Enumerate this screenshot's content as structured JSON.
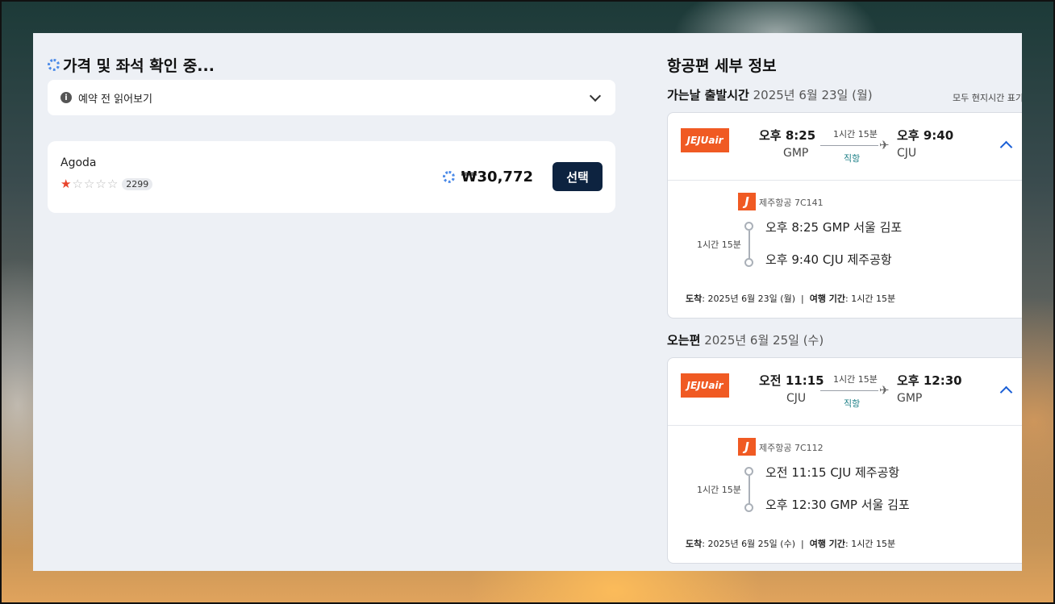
{
  "left": {
    "checking_text": "가격 및 좌석 확인 중...",
    "read_before": "예약 전 읽어보기",
    "offer": {
      "provider": "Agoda",
      "rating": 1,
      "rating_max": 5,
      "reviews": "2299",
      "price": "₩30,772",
      "select_label": "선택"
    }
  },
  "right": {
    "title": "항공편 세부 정보",
    "local_time_note": "모두 현지시간 표기",
    "legs": [
      {
        "label": "가는날 출발시간",
        "date": "2025년 6월 23일 (월)",
        "airline_logo": "JEJUair",
        "dep_time": "오후 8:25",
        "dep_code": "GMP",
        "duration": "1시간 15분",
        "stops": "직항",
        "arr_time": "오후 9:40",
        "arr_code": "CJU",
        "flight": "제주항공 7C141",
        "seg_duration": "1시간 15분",
        "seg_dep": "오후 8:25 GMP 서울 김포",
        "seg_arr": "오후 9:40 CJU 제주공항",
        "arrival_label": "도착",
        "arrival_value": ": 2025년 6월 23일 (월)",
        "travel_label": "여행 기간",
        "travel_value": ": 1시간 15분"
      },
      {
        "label": "오는편",
        "date": "2025년 6월 25일 (수)",
        "airline_logo": "JEJUair",
        "dep_time": "오전 11:15",
        "dep_code": "CJU",
        "duration": "1시간 15분",
        "stops": "직항",
        "arr_time": "오후 12:30",
        "arr_code": "GMP",
        "flight": "제주항공 7C112",
        "seg_duration": "1시간 15분",
        "seg_dep": "오전 11:15 CJU 제주공항",
        "seg_arr": "오후 12:30 GMP 서울 김포",
        "arrival_label": "도착",
        "arrival_value": ": 2025년 6월 25일 (수)",
        "travel_label": "여행 기간",
        "travel_value": ": 1시간 15분"
      }
    ]
  },
  "colors": {
    "jeju_orange": "#f05a23",
    "select_button": "#0d2340",
    "star_on": "#e8442c",
    "direct_text": "#1c7f86",
    "chevron_blue": "#1a5fd6"
  }
}
